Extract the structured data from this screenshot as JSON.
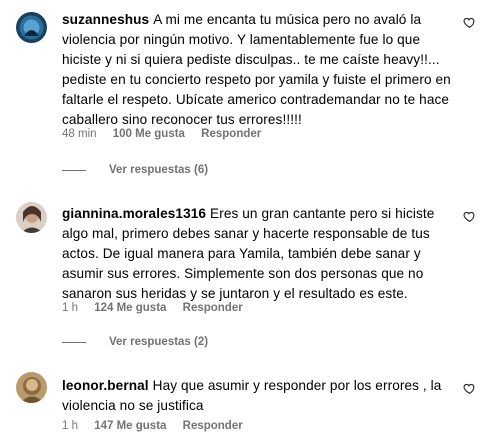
{
  "comments": [
    {
      "username": "suzanneshus",
      "text": "A mi me encanta tu música pero no avaló la violencia por ningún motivo. Y lamentablemente fue lo que hiciste y ni si quiera pediste disculpas.. te me caíste heavy!!... pediste en tu concierto respeto por yamila y fuiste el primero en faltarle el respeto. Ubícate americo contrademandar no te hace caballero sino reconocer tus errores!!!!!",
      "time": "48 min",
      "likes": "100 Me gusta",
      "reply_label": "Responder",
      "view_replies": "Ver respuestas (6)",
      "avatar_icon": "profile-photo"
    },
    {
      "username": "giannina.morales1316",
      "text": "Eres un gran cantante pero si hiciste algo mal, primero debes sanar y hacerte responsable de tus actos. De igual manera para Yamila, también debe sanar y asumir sus errores. Simplemente son dos personas que no sanaron sus heridas y se juntaron y el resultado es este.",
      "time": "1 h",
      "likes": "124 Me gusta",
      "reply_label": "Responder",
      "view_replies": "Ver respuestas (2)",
      "avatar_icon": "profile-photo"
    },
    {
      "username": "leonor.bernal",
      "text": "Hay que asumir y responder por los errores , la violencia no se justifica",
      "time": "1 h",
      "likes": "147 Me gusta",
      "reply_label": "Responder",
      "avatar_icon": "profile-photo"
    }
  ],
  "colors": {
    "text": "#000000",
    "meta": "#737373",
    "background": "#ffffff"
  },
  "icons": {
    "like": "heart-outline-icon"
  }
}
